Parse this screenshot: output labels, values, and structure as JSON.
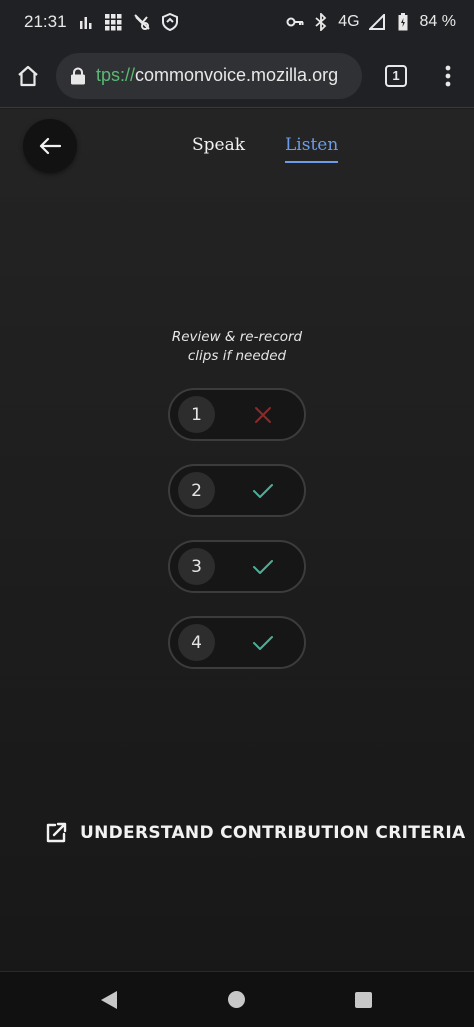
{
  "status_bar": {
    "time": "21:31",
    "network": "4G",
    "battery": "84 %",
    "icons_left": [
      "bar-chart-icon",
      "grid-icon",
      "no-notification-icon",
      "shield-icon"
    ],
    "icons_right": [
      "key-icon",
      "bluetooth-icon",
      "signal-icon",
      "battery-icon"
    ]
  },
  "browser": {
    "url_scheme": "tps://",
    "url_host": "commonvoice.mozilla.org",
    "tab_count": "1"
  },
  "page": {
    "tabs": [
      {
        "label": "Speak",
        "active": false
      },
      {
        "label": "Listen",
        "active": true
      }
    ],
    "review_line1": "Review & re-record",
    "review_line2": "clips if needed",
    "clips": [
      {
        "number": "1",
        "status": "rejected"
      },
      {
        "number": "2",
        "status": "accepted"
      },
      {
        "number": "3",
        "status": "accepted"
      },
      {
        "number": "4",
        "status": "accepted"
      }
    ],
    "criteria_label": "UNDERSTAND CONTRIBUTION CRITERIA"
  },
  "colors": {
    "accent_blue": "#6c9bea",
    "check_green": "#4fae9a",
    "cross_red": "#8a2a2a",
    "url_scheme_green": "#5bb974"
  }
}
